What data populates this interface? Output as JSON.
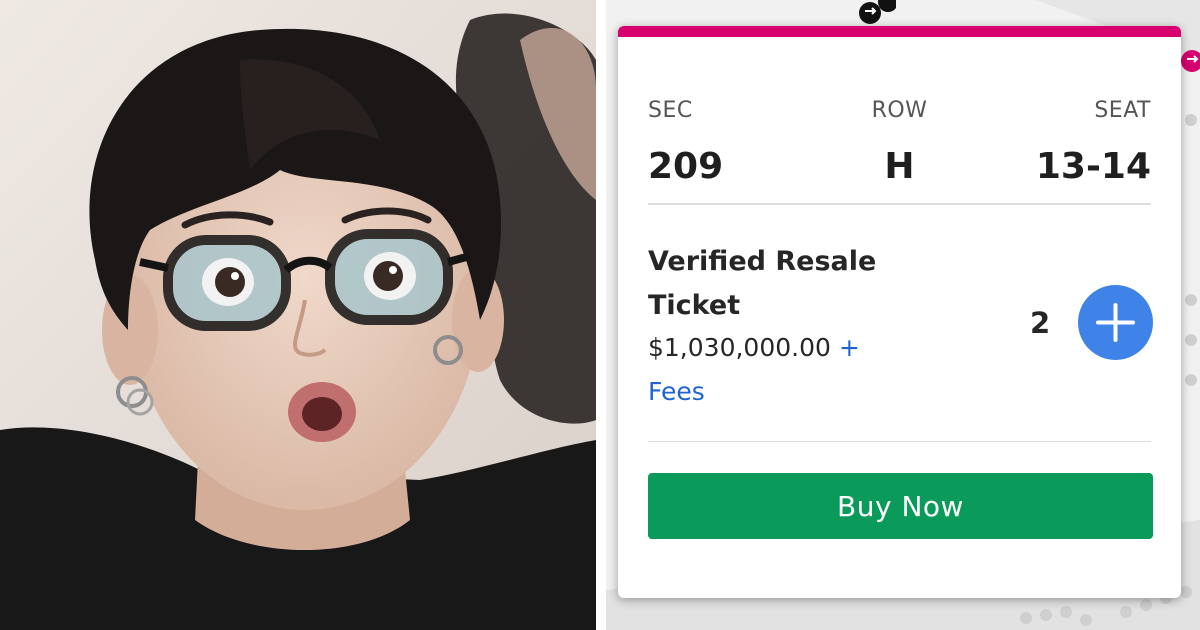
{
  "photo": {
    "subject": "surprised-person-with-glasses",
    "colors": {
      "hair": "#1b1716",
      "skin": "#e6c9b9",
      "lens": "#a9c6cc",
      "shirt": "#1a1a1a",
      "wall": "#e9e2dd"
    }
  },
  "ticket": {
    "headers": {
      "sec": "SEC",
      "row": "ROW",
      "seat": "SEAT"
    },
    "values": {
      "sec": "209",
      "row": "H",
      "seat": "13-14"
    },
    "description": "Verified Resale Ticket",
    "price": "$1,030,000.00",
    "fees_label": "+ Fees",
    "quantity": "2",
    "buy_label": "Buy Now",
    "colors": {
      "accent": "#d6006e",
      "buy": "#0a9b5b",
      "plus": "#3f83e8",
      "link": "#1f63d4"
    },
    "icons": [
      "plus-icon",
      "swap-icon"
    ]
  }
}
